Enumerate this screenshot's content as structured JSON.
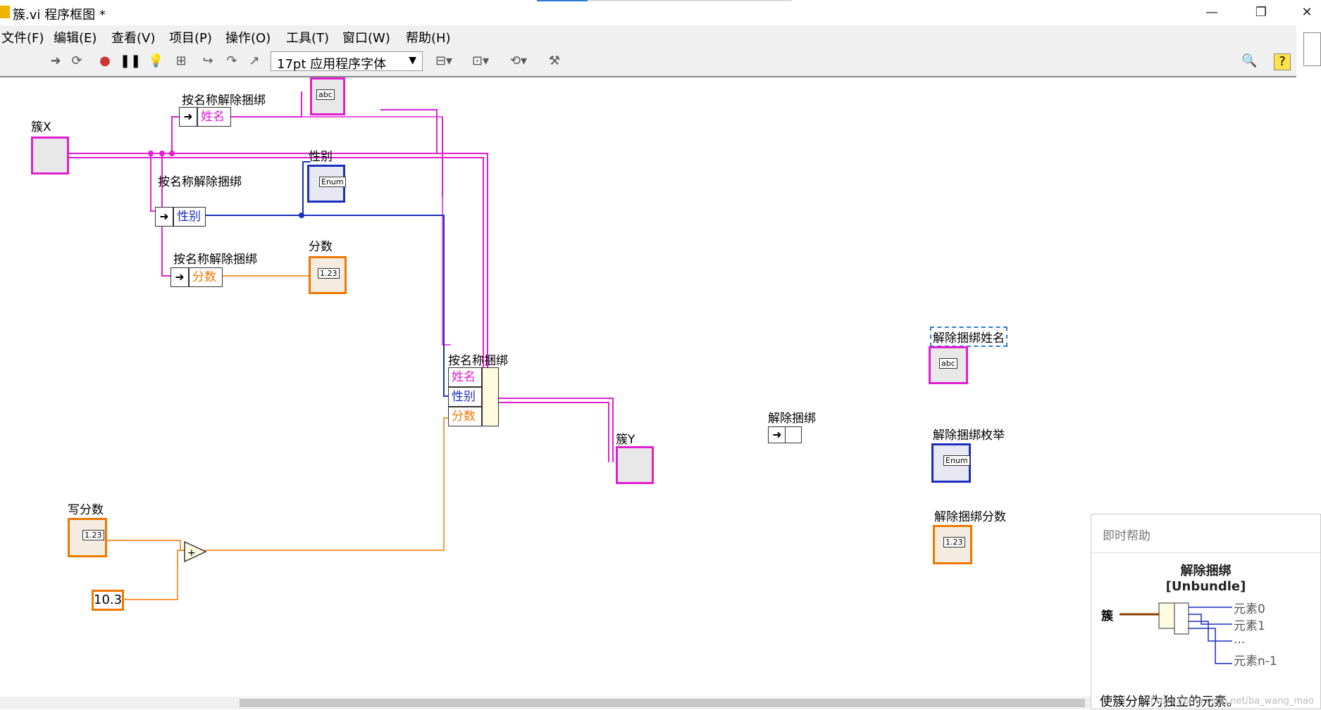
{
  "window": {
    "title": "簇.vi 程序框图 *",
    "minimize": "—",
    "restore": "❐",
    "close": "✕"
  },
  "menu": [
    "文件(F)",
    "编辑(E)",
    "查看(V)",
    "项目(P)",
    "操作(O)",
    "工具(T)",
    "窗口(W)",
    "帮助(H)"
  ],
  "toolbar": {
    "font": "17pt 应用程序字体"
  },
  "diagram": {
    "cluster_x_label": "簇X",
    "cluster_y_label": "簇Y",
    "unbundle1_label": "按名称解除捆绑",
    "unbundle1_field": "姓名",
    "unbundle2_label": "按名称解除捆绑",
    "unbundle2_field": "性别",
    "unbundle3_label": "按名称解除捆绑",
    "unbundle3_field": "分数",
    "gender_label": "性别",
    "score_label": "分数",
    "bundle_label": "按名称捆绑",
    "bundle_fields": [
      "姓名",
      "性别",
      "分数"
    ],
    "write_score_label": "写分数",
    "constant_value": "10.3",
    "unbundle_label": "解除捆绑",
    "unbundle_name_label": "解除捆绑姓名",
    "unbundle_enum_label": "解除捆绑枚举",
    "unbundle_score_label": "解除捆绑分数",
    "tag_abc": "abc",
    "tag_enum": "Enum",
    "tag_dbl": "1.23"
  },
  "help": {
    "header": "即时帮助",
    "title": "解除捆绑",
    "subtitle": "[Unbundle]",
    "input_label": "簇",
    "outputs": [
      "元素0",
      "元素1",
      "...",
      "元素n-1"
    ],
    "description": "使簇分解为独立的元素。",
    "watermark": "https://blog.csdn.net/ba_wang_mao"
  },
  "colors": {
    "string": "#e020d0",
    "enum": "#1a2fbf",
    "numeric": "#f07800",
    "cluster": "#e020d0"
  }
}
